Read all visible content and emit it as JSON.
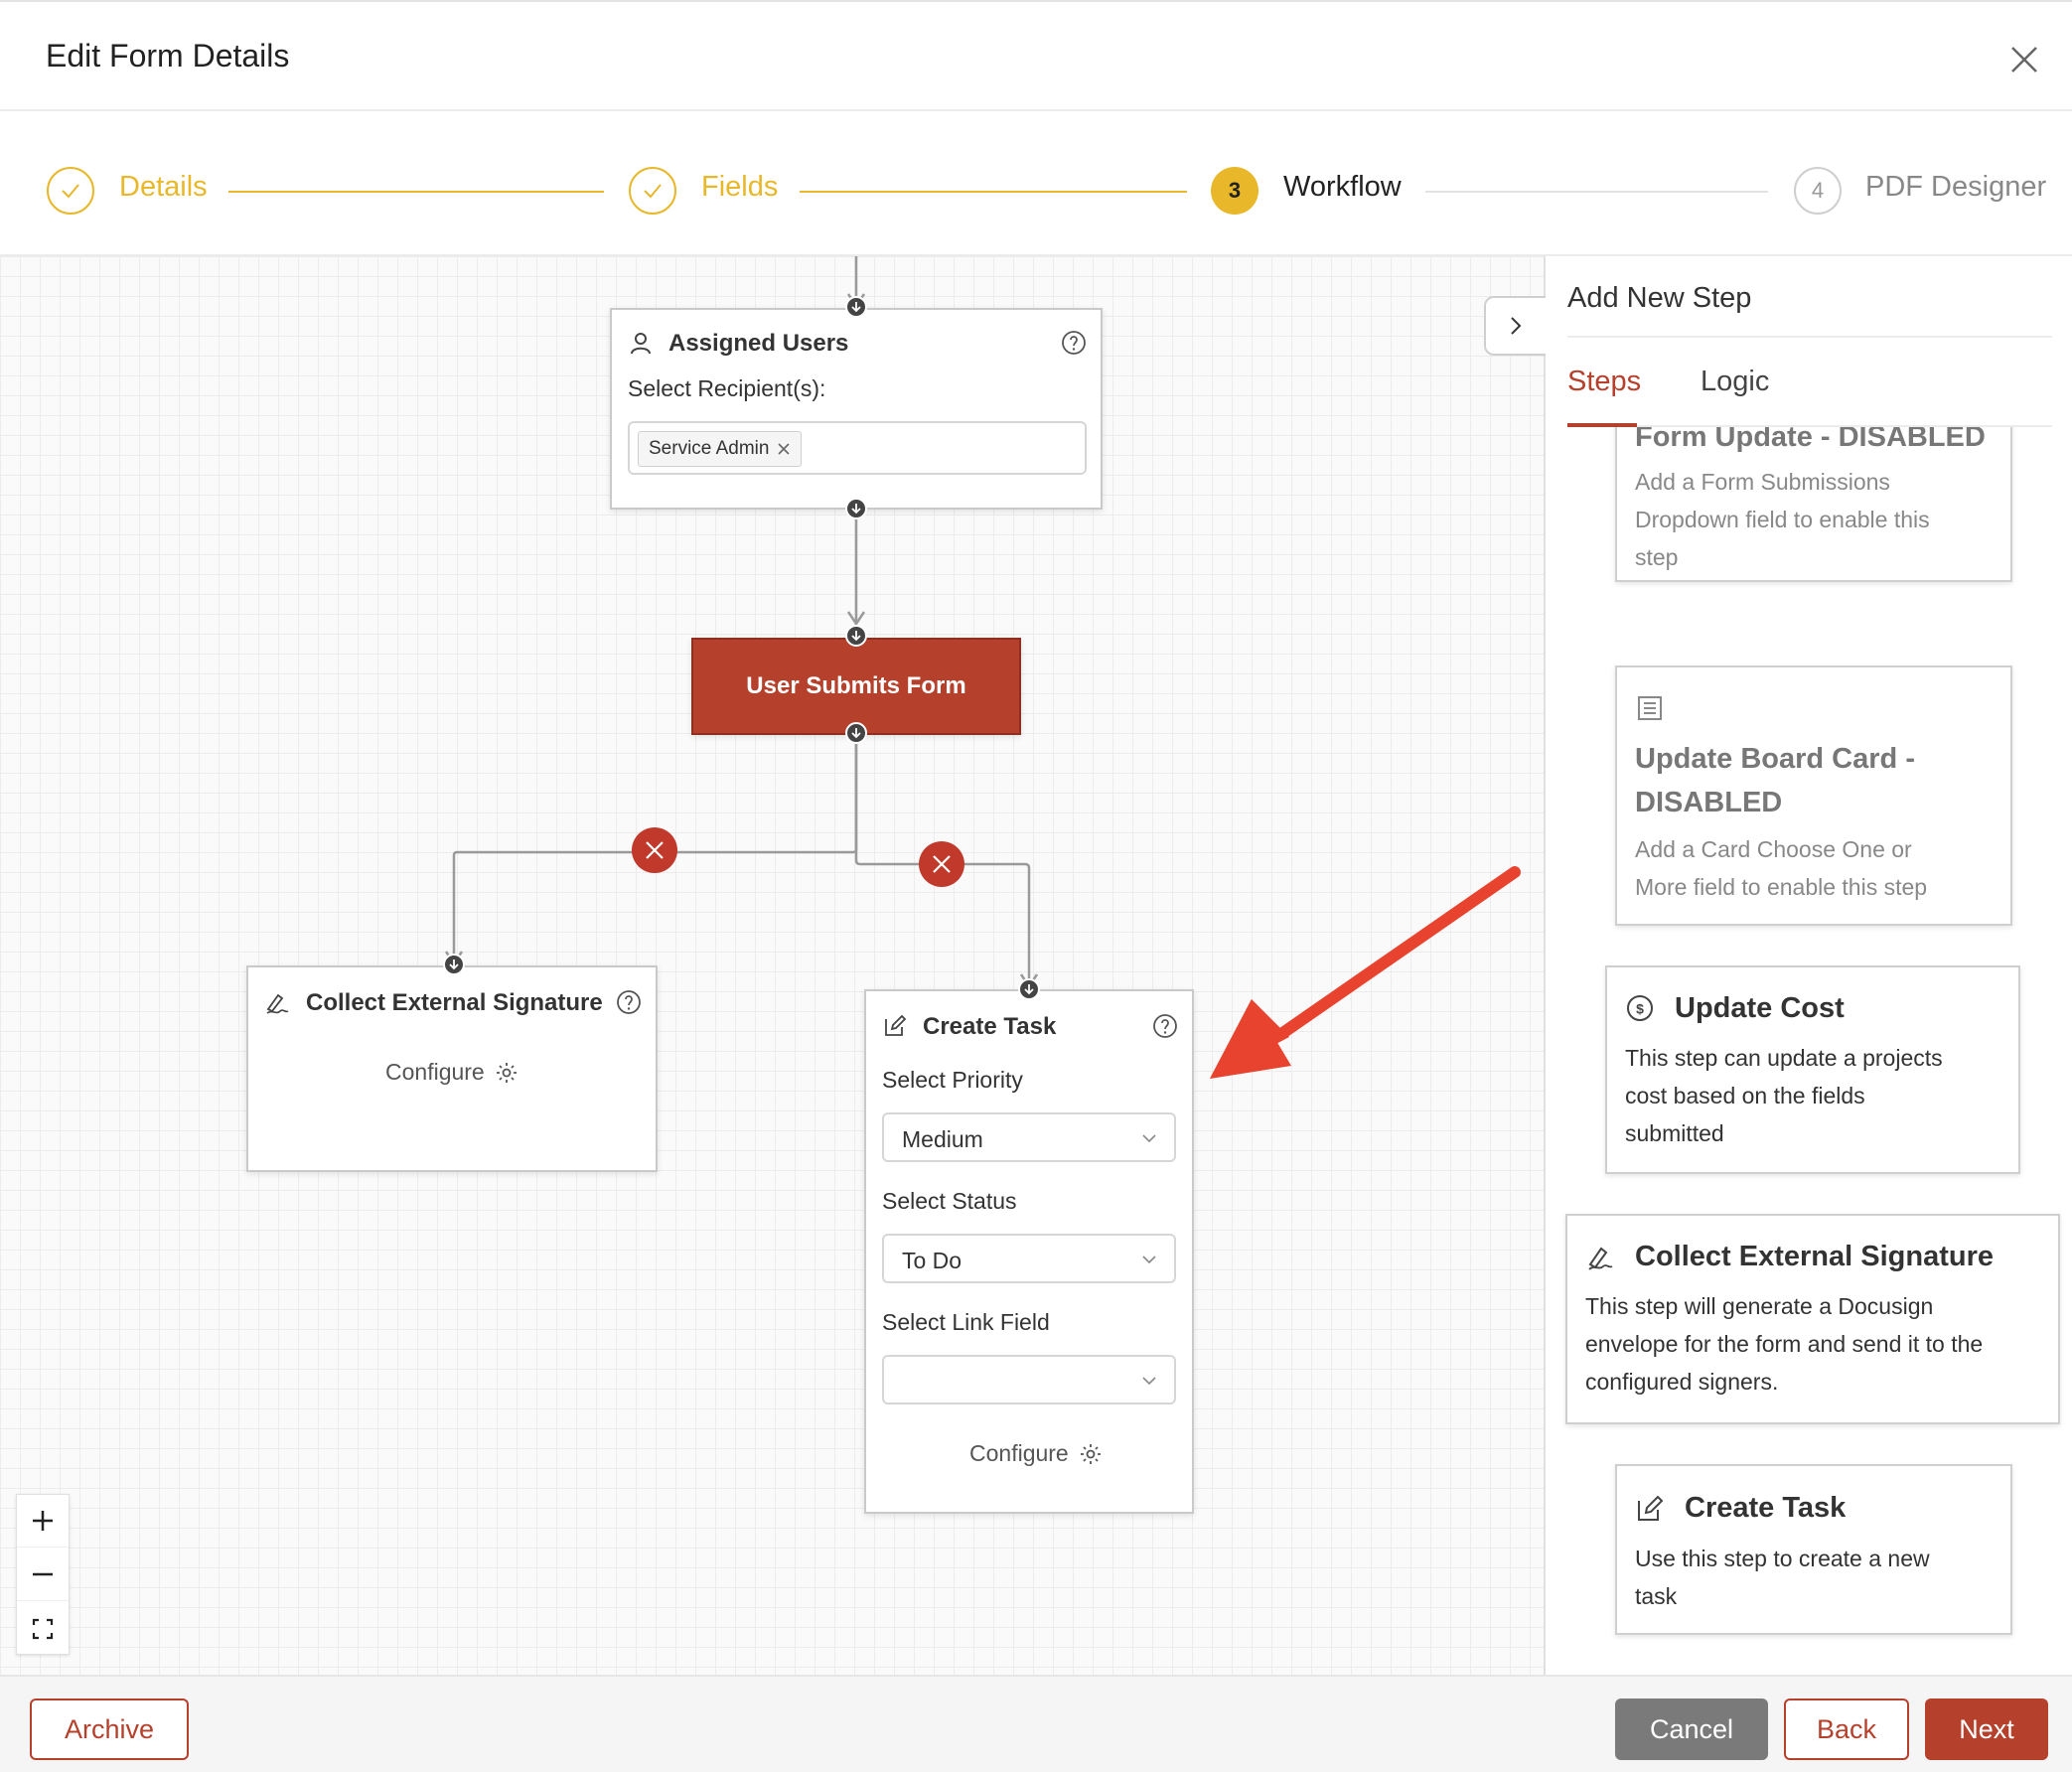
{
  "header": {
    "title": "Edit Form Details"
  },
  "stepper": {
    "steps": [
      {
        "number": "",
        "label": "Details"
      },
      {
        "number": "",
        "label": "Fields"
      },
      {
        "number": "3",
        "label": "Workflow"
      },
      {
        "number": "4",
        "label": "PDF Designer"
      }
    ]
  },
  "canvas": {
    "assigned_users": {
      "title": "Assigned Users",
      "recipients_label": "Select Recipient(s):",
      "recipient_tag": "Service Admin"
    },
    "trigger": {
      "label": "User Submits Form"
    },
    "collect_signature": {
      "title": "Collect External Signature",
      "configure_label": "Configure"
    },
    "create_task": {
      "title": "Create Task",
      "priority_label": "Select Priority",
      "priority_value": "Medium",
      "status_label": "Select Status",
      "status_value": "To Do",
      "link_label": "Select Link Field",
      "link_value": "",
      "configure_label": "Configure"
    }
  },
  "panel": {
    "title": "Add New Step",
    "tabs": [
      {
        "label": "Steps"
      },
      {
        "label": "Logic"
      }
    ],
    "cards": [
      {
        "title": "Form Update - DISABLED",
        "desc_lines": [
          "Add a Form Submissions",
          "Dropdown field to enable this",
          "step"
        ]
      },
      {
        "title_lines": [
          "Update Board Card -",
          "DISABLED"
        ],
        "desc_lines": [
          "Add a Card Choose One or",
          "More field to enable this step"
        ]
      },
      {
        "title": "Update Cost",
        "desc_lines": [
          "This step can update a projects",
          "cost based on the fields",
          "submitted"
        ]
      },
      {
        "title": "Collect External Signature",
        "desc_lines": [
          "This step will generate a Docusign",
          "envelope for the form and send it to the",
          "configured signers."
        ]
      },
      {
        "title": "Create Task",
        "desc_lines": [
          "Use this step to create a new",
          "task"
        ]
      }
    ]
  },
  "footer": {
    "archive": "Archive",
    "cancel": "Cancel",
    "back": "Back",
    "next": "Next"
  },
  "colors": {
    "accent": "#b5402c",
    "step_done": "#e8b82a",
    "annotation_arrow": "#e8432e"
  },
  "icons": [
    "close-icon",
    "check-icon",
    "user-icon",
    "help-icon",
    "signature-icon",
    "edit-icon",
    "gear-icon",
    "chevron-down-icon",
    "chevron-right-icon",
    "dollar-icon",
    "board-icon",
    "plus-icon",
    "minus-icon",
    "fit-view-icon",
    "delete-icon",
    "arrow-down-icon"
  ]
}
